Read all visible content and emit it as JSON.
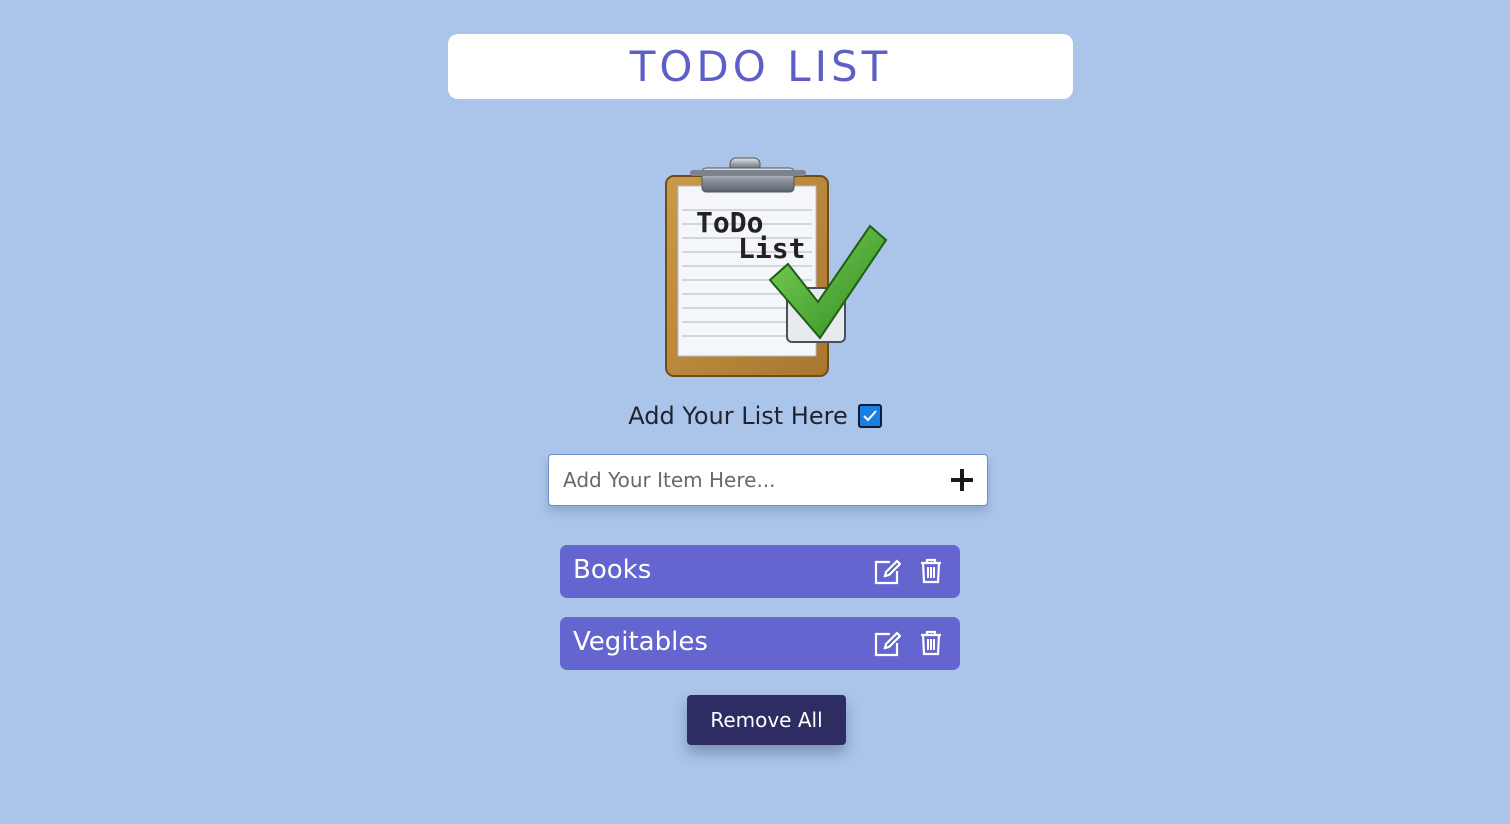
{
  "header": {
    "title": "TODO LIST"
  },
  "hero": {
    "image_text_line1": "ToDo",
    "image_text_line2": "List"
  },
  "subtitle": {
    "text": "Add Your List Here",
    "check_icon": "checkbox-checked-icon"
  },
  "add_item": {
    "placeholder": "Add Your Item Here...",
    "value": "",
    "button_icon": "plus-icon"
  },
  "items": [
    {
      "label": "Books",
      "edit_icon": "edit-icon",
      "delete_icon": "trash-icon"
    },
    {
      "label": "Vegitables",
      "edit_icon": "edit-icon",
      "delete_icon": "trash-icon"
    }
  ],
  "remove_all": {
    "label": "Remove All"
  },
  "colors": {
    "background": "#abc5ea",
    "accent": "#5c5fc8",
    "item_bg": "#6465cf",
    "button_bg": "#2d2d64",
    "checkbox_blue": "#1a7fe0"
  }
}
